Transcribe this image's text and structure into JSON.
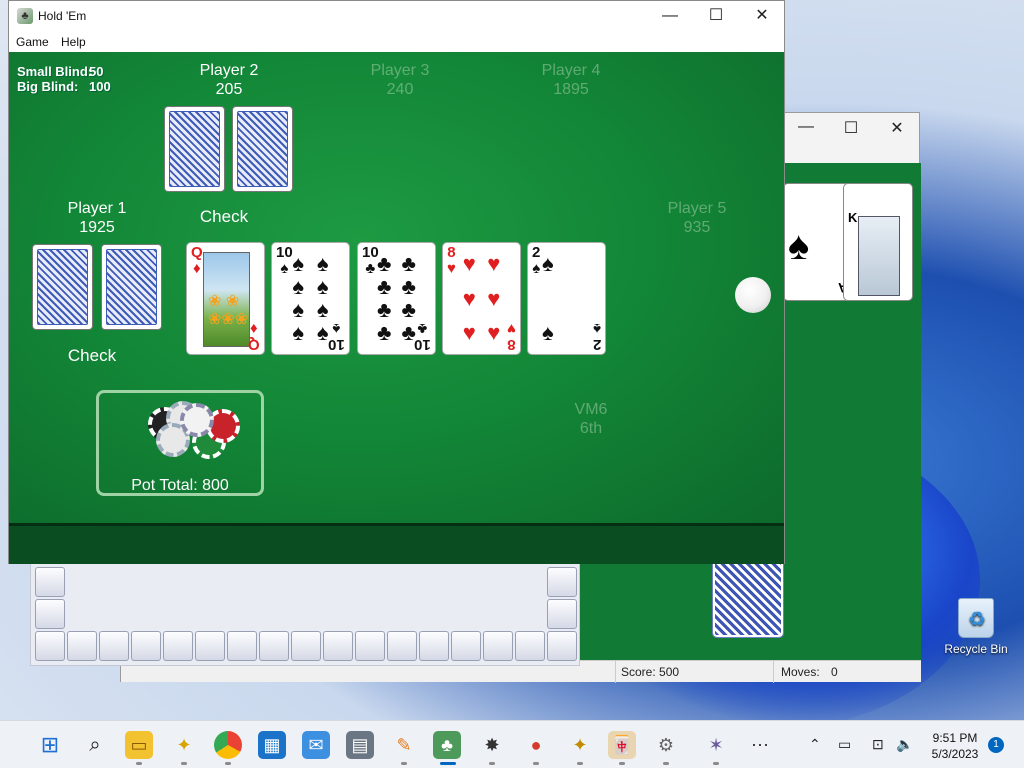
{
  "desktop": {
    "recycle_bin_label": "Recycle Bin"
  },
  "solitaire": {
    "score_label": "Score: 500",
    "moves_label": "Moves:",
    "moves_value": "0",
    "controls": {
      "minimize": "—",
      "maximize": "☐",
      "close": "✕"
    },
    "cards": {
      "k_rank": "K",
      "a_rank": "A"
    }
  },
  "holdem": {
    "title": "Hold 'Em",
    "controls": {
      "minimize": "—",
      "maximize": "☐",
      "close": "✕"
    },
    "menu": [
      "Game",
      "Help"
    ],
    "blinds": {
      "small_label": "Small Blind:",
      "small_value": "50",
      "big_label": "Big Blind:",
      "big_value": "100"
    },
    "players": {
      "p1": {
        "name": "Player 1",
        "chips": "1925",
        "action": "Check"
      },
      "p2": {
        "name": "Player 2",
        "chips": "205",
        "action": "Check"
      },
      "p3": {
        "name": "Player 3",
        "chips": "240"
      },
      "p4": {
        "name": "Player 4",
        "chips": "1895"
      },
      "p5": {
        "name": "Player 5",
        "chips": "935"
      },
      "vm": {
        "name": "VM6",
        "place": "6th"
      }
    },
    "community_cards": [
      {
        "rank": "Q",
        "suit": "♦",
        "color": "red"
      },
      {
        "rank": "10",
        "suit": "♠",
        "color": "black"
      },
      {
        "rank": "10",
        "suit": "♣",
        "color": "black"
      },
      {
        "rank": "8",
        "suit": "♥",
        "color": "red"
      },
      {
        "rank": "2",
        "suit": "♠",
        "color": "black"
      }
    ],
    "pot_label": "Pot Total: 800"
  },
  "taskbar": {
    "icons": [
      "start-icon",
      "search-icon",
      "file-explorer-icon",
      "bee-game-icon",
      "chrome-icon",
      "store-icon",
      "mail-icon",
      "calculator-icon",
      "paint-icon",
      "holdem-icon",
      "minesweeper-icon",
      "ladybug-icon",
      "bee-icon",
      "mahjong-icon",
      "gear-game-icon",
      "spider-icon",
      "more-icon"
    ],
    "time": "9:51 PM",
    "date": "5/3/2023",
    "notification_count": "1"
  }
}
